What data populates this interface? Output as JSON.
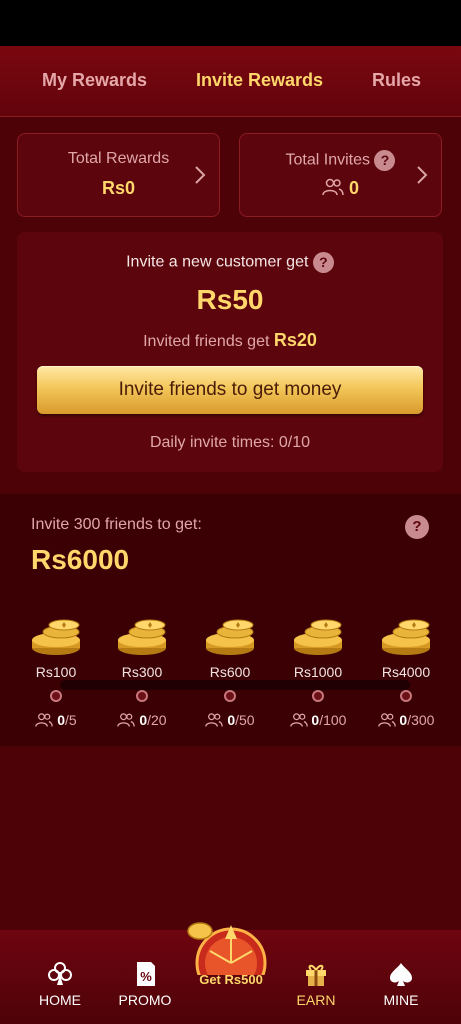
{
  "tabs": [
    {
      "label": "My Rewards"
    },
    {
      "label": "Invite Rewards"
    },
    {
      "label": "Rules"
    }
  ],
  "stats": {
    "total_rewards_label": "Total Rewards",
    "total_rewards_value": "Rs0",
    "total_invites_label": "Total Invites",
    "total_invites_value": "0"
  },
  "invite": {
    "title": "Invite a new customer get",
    "amount": "Rs50",
    "friends_label": "Invited friends get",
    "friends_amount": "Rs20",
    "button": "Invite friends to get money",
    "daily": "Daily invite times: 0/10"
  },
  "milestone": {
    "title": "Invite 300 friends to get:",
    "amount": "Rs6000",
    "steps": [
      {
        "amount": "Rs100",
        "current": "0",
        "target": "/5"
      },
      {
        "amount": "Rs300",
        "current": "0",
        "target": "/20"
      },
      {
        "amount": "Rs600",
        "current": "0",
        "target": "/50"
      },
      {
        "amount": "Rs1000",
        "current": "0",
        "target": "/100"
      },
      {
        "amount": "Rs4000",
        "current": "0",
        "target": "/300"
      }
    ]
  },
  "help_mark": "?",
  "nav": {
    "home": "HOME",
    "promo": "PROMO",
    "center": "Get Rs500",
    "earn": "EARN",
    "mine": "MINE"
  },
  "colors": {
    "accent_gold": "#ffd76a",
    "background": "#4d0208",
    "header": "#7a0710"
  }
}
